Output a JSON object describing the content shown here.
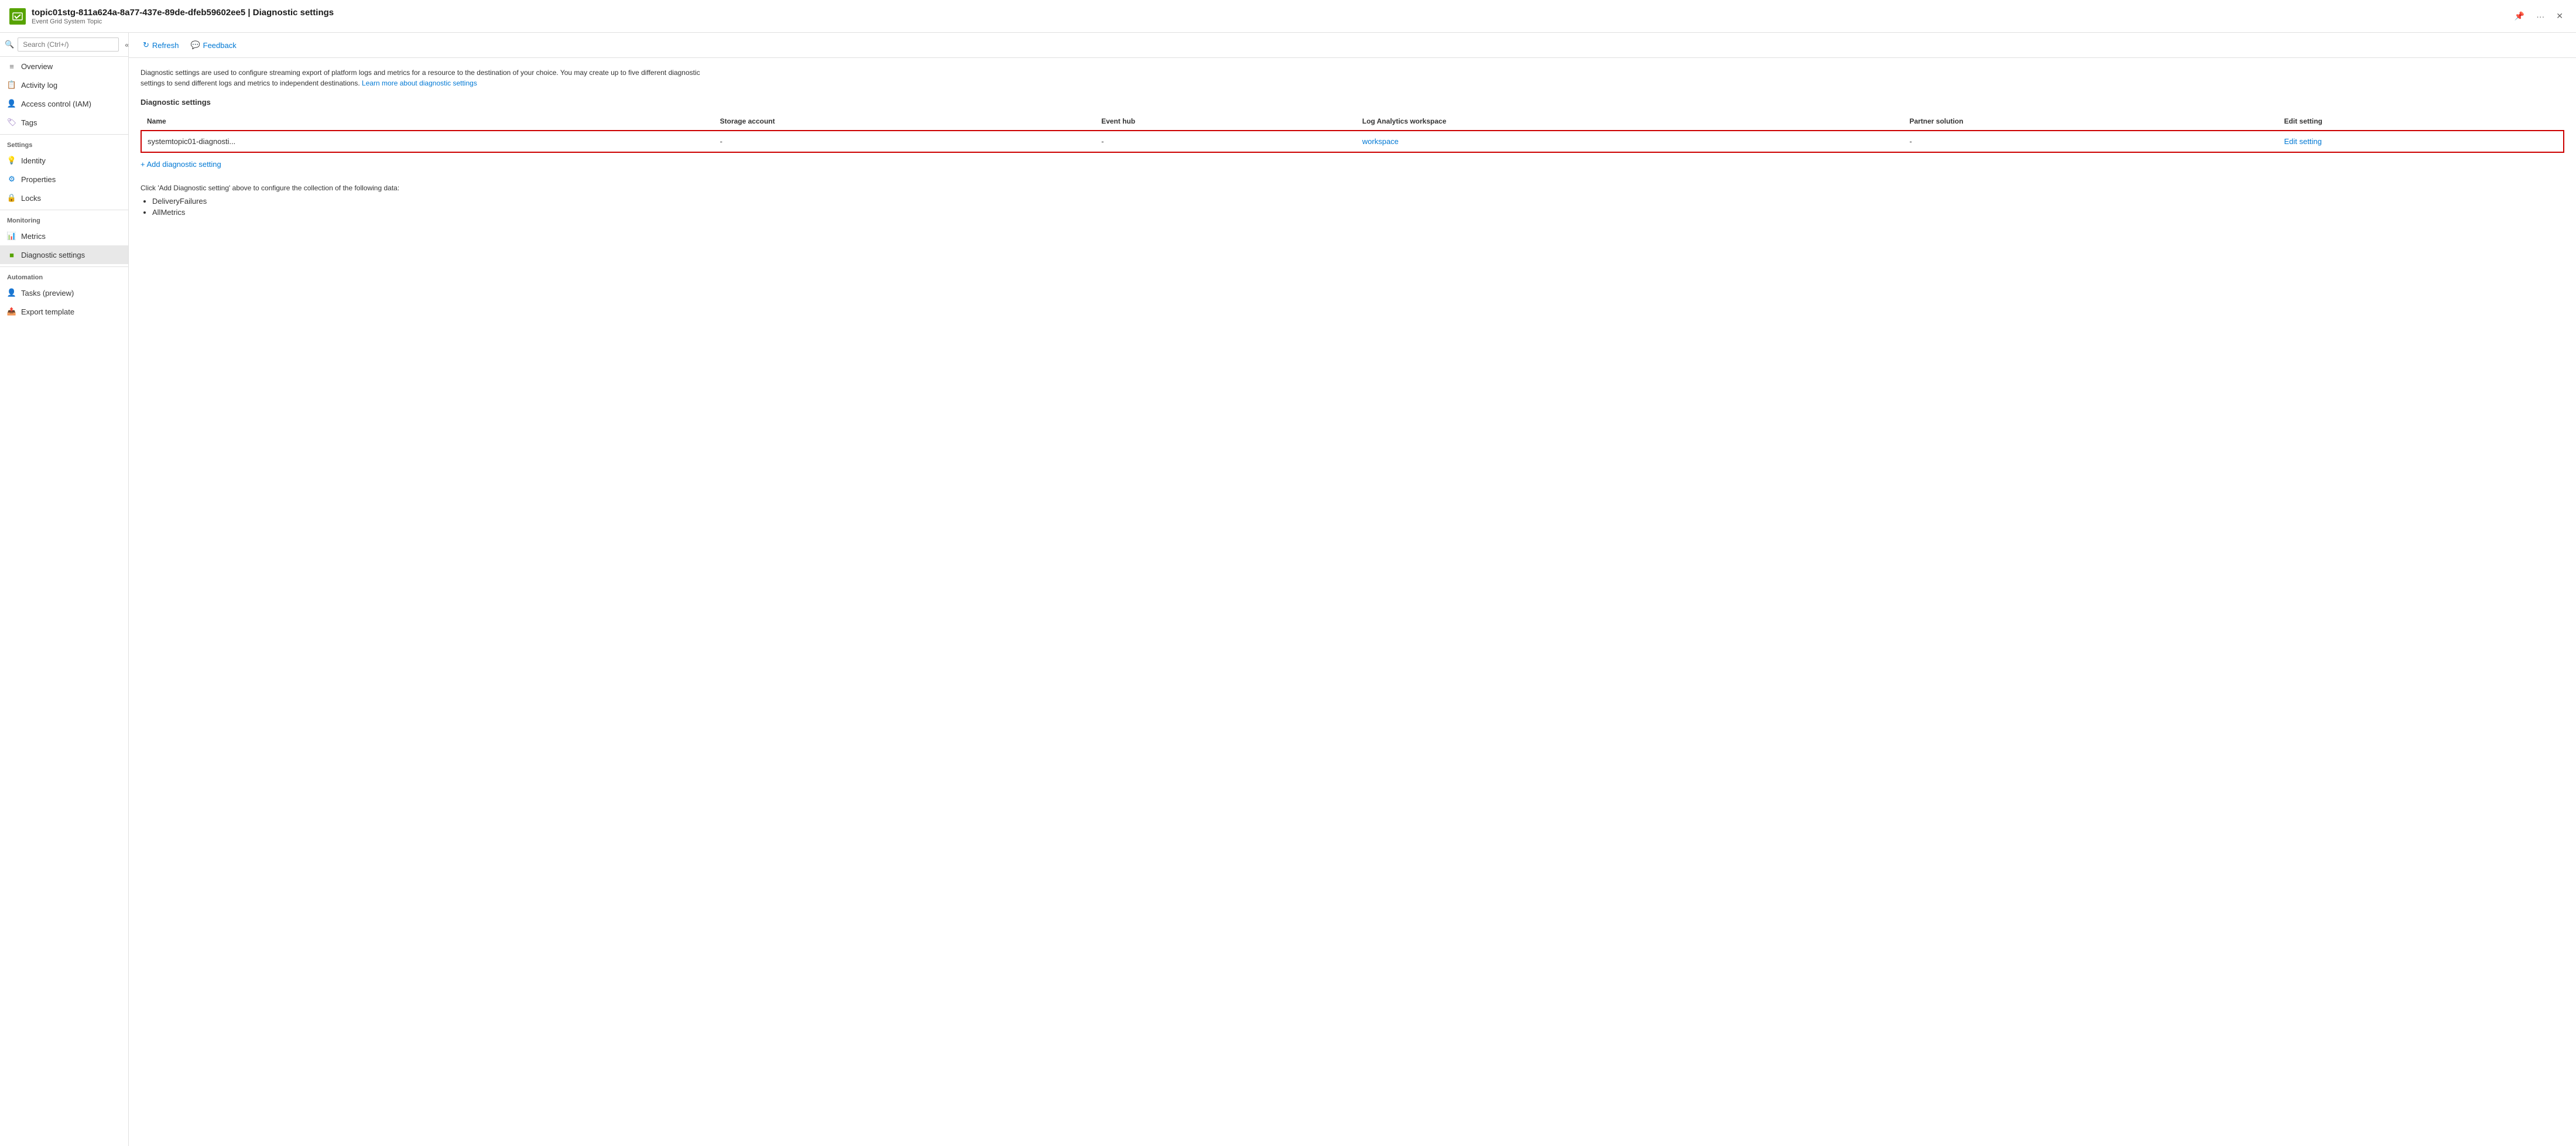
{
  "header": {
    "resource_name": "topic01stg-811a624a-8a77-437e-89de-dfeb59602ee5",
    "page_title": "Diagnostic settings",
    "resource_type": "Event Grid System Topic",
    "pin_label": "Pin",
    "more_label": "More",
    "close_label": "Close"
  },
  "sidebar": {
    "search_placeholder": "Search (Ctrl+/)",
    "collapse_label": "Collapse",
    "items": [
      {
        "id": "overview",
        "label": "Overview",
        "icon": "overview"
      },
      {
        "id": "activity-log",
        "label": "Activity log",
        "icon": "activity"
      },
      {
        "id": "access-control",
        "label": "Access control (IAM)",
        "icon": "access"
      },
      {
        "id": "tags",
        "label": "Tags",
        "icon": "tags"
      }
    ],
    "sections": [
      {
        "label": "Settings",
        "items": [
          {
            "id": "identity",
            "label": "Identity",
            "icon": "identity"
          },
          {
            "id": "properties",
            "label": "Properties",
            "icon": "properties"
          },
          {
            "id": "locks",
            "label": "Locks",
            "icon": "locks"
          }
        ]
      },
      {
        "label": "Monitoring",
        "items": [
          {
            "id": "metrics",
            "label": "Metrics",
            "icon": "metrics"
          },
          {
            "id": "diagnostic-settings",
            "label": "Diagnostic settings",
            "icon": "diagnostic",
            "active": true
          }
        ]
      },
      {
        "label": "Automation",
        "items": [
          {
            "id": "tasks",
            "label": "Tasks (preview)",
            "icon": "tasks"
          },
          {
            "id": "export-template",
            "label": "Export template",
            "icon": "export"
          }
        ]
      }
    ]
  },
  "toolbar": {
    "refresh_label": "Refresh",
    "feedback_label": "Feedback"
  },
  "page": {
    "description": "Diagnostic settings are used to configure streaming export of platform logs and metrics for a resource to the destination of your choice. You may create up to five different diagnostic settings to send different logs and metrics to independent destinations.",
    "learn_more_text": "Learn more about diagnostic settings",
    "section_title": "Diagnostic settings",
    "table": {
      "columns": [
        "Name",
        "Storage account",
        "Event hub",
        "Log Analytics workspace",
        "Partner solution",
        "Edit setting"
      ],
      "rows": [
        {
          "name": "systemtopic01-diagnosti...",
          "storage_account": "-",
          "event_hub": "-",
          "log_analytics": "workspace",
          "partner_solution": "-",
          "edit_setting": "Edit setting"
        }
      ]
    },
    "add_setting_label": "+ Add diagnostic setting",
    "click_note": "Click 'Add Diagnostic setting' above to configure the collection of the following data:",
    "bullet_items": [
      "DeliveryFailures",
      "AllMetrics"
    ]
  }
}
